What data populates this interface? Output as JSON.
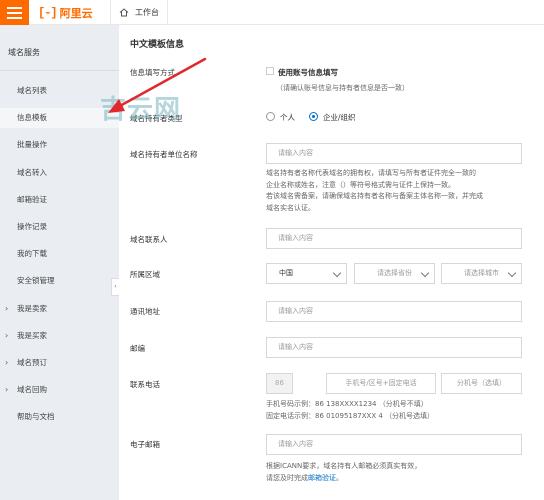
{
  "header": {
    "logo_mark": "[-]",
    "logo_text": "阿里云",
    "breadcrumb": "工作台"
  },
  "sidebar": {
    "title": "域名服务",
    "items": [
      {
        "label": "域名列表",
        "chevron": false,
        "active": false
      },
      {
        "label": "信息模板",
        "chevron": false,
        "active": true
      },
      {
        "label": "批量操作",
        "chevron": false,
        "active": false
      },
      {
        "label": "域名转入",
        "chevron": false,
        "active": false
      },
      {
        "label": "邮箱验证",
        "chevron": false,
        "active": false
      },
      {
        "label": "操作记录",
        "chevron": false,
        "active": false
      },
      {
        "label": "我的下载",
        "chevron": false,
        "active": false
      },
      {
        "label": "安全锁管理",
        "chevron": false,
        "active": false
      },
      {
        "label": "我是卖家",
        "chevron": true,
        "active": false
      },
      {
        "label": "我是买家",
        "chevron": true,
        "active": false
      },
      {
        "label": "域名预订",
        "chevron": true,
        "active": false
      },
      {
        "label": "域名回购",
        "chevron": true,
        "active": false
      },
      {
        "label": "帮助与文档",
        "chevron": false,
        "active": false
      }
    ]
  },
  "form": {
    "section_title": "中文模板信息",
    "info_fill": {
      "label": "信息填写方式",
      "checkbox_label": "使用账号信息填写",
      "hint": "（请确认账号信息与持有者信息是否一致）"
    },
    "holder_type": {
      "label": "域名持有者类型",
      "options": [
        "个人",
        "企业/组织"
      ],
      "selected": "企业/组织"
    },
    "org_name": {
      "label": "域名持有者单位名称",
      "placeholder": "请输入内容",
      "help": [
        "域名持有者名称代表域名的拥有权，请填写与所有者证件完全一致的",
        "企业名称或姓名，注意（）等符号格式需与证件上保持一致。",
        "若该域名需备案，请确保域名持有者名称与备案主体名称一致，并完成",
        "域名实名认证。"
      ]
    },
    "contact": {
      "label": "域名联系人",
      "placeholder": "请输入内容"
    },
    "region": {
      "label": "所属区域",
      "country": "中国",
      "province_placeholder": "请选择省份",
      "city_placeholder": "请选择城市"
    },
    "address": {
      "label": "通讯地址",
      "placeholder": "请输入内容"
    },
    "postcode": {
      "label": "邮编",
      "placeholder": "请输入内容"
    },
    "phone": {
      "label": "联系电话",
      "country_code": "86",
      "number_placeholder": "手机号/区号+固定电话",
      "ext_placeholder": "分机号（选填）",
      "example_mobile": "手机号码示例：86 138XXXX1234    （分机号不填）",
      "example_fixed": "固定电话示例：86 01095187XXX 4  （分机号选填）"
    },
    "email": {
      "label": "电子邮箱",
      "placeholder": "请输入内容",
      "notice_1": "根据ICANN要求，域名持有人邮箱必须真实有效，",
      "notice_2_prefix": "请您及时完成",
      "notice_2_link": "邮箱验证",
      "notice_2_suffix": "。"
    }
  },
  "overlay": {
    "watermark": "吉云网"
  },
  "colors": {
    "brand_orange": "#ff6a00",
    "link_blue": "#0070cc",
    "annotation_red": "#e0282d",
    "sidebar_bg": "#eaedf1"
  }
}
